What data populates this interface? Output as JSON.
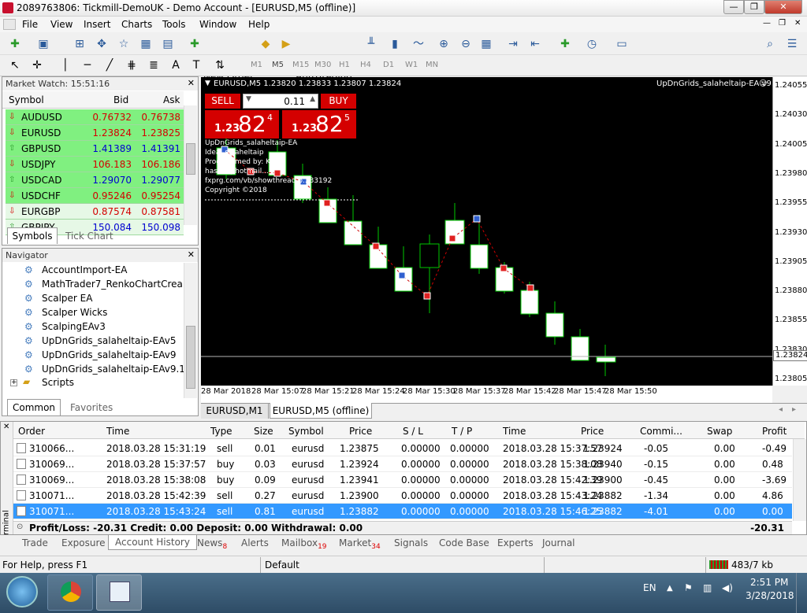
{
  "window": {
    "title": "2089763806: Tickmill-DemoUK - Demo Account - [EURUSD,M5 (offline)]",
    "min": "—",
    "max": "❐",
    "close": "✕"
  },
  "menu": [
    "File",
    "View",
    "Insert",
    "Charts",
    "Tools",
    "Window",
    "Help"
  ],
  "toolbar": {
    "new_order": "New Order",
    "autotrading": "AutoTrading"
  },
  "timeframes": [
    "M1",
    "M5",
    "M15",
    "M30",
    "H1",
    "H4",
    "D1",
    "W1",
    "MN"
  ],
  "market_watch": {
    "title": "Market Watch: 15:51:16",
    "cols": [
      "Symbol",
      "Bid",
      "Ask"
    ],
    "rows": [
      {
        "s": "AUDUSD",
        "b": "0.76732",
        "a": "0.76738",
        "dir": "down"
      },
      {
        "s": "EURUSD",
        "b": "1.23824",
        "a": "1.23825",
        "dir": "down"
      },
      {
        "s": "GBPUSD",
        "b": "1.41389",
        "a": "1.41391",
        "dir": "up"
      },
      {
        "s": "USDJPY",
        "b": "106.183",
        "a": "106.186",
        "dir": "down"
      },
      {
        "s": "USDCAD",
        "b": "1.29070",
        "a": "1.29077",
        "dir": "up"
      },
      {
        "s": "USDCHF",
        "b": "0.95246",
        "a": "0.95254",
        "dir": "down"
      },
      {
        "s": "EURGBP",
        "b": "0.87574",
        "a": "0.87581",
        "dir": "down"
      },
      {
        "s": "GBPJPY",
        "b": "150.084",
        "a": "150.098",
        "dir": "up"
      }
    ],
    "tabs": [
      "Symbols",
      "Tick Chart"
    ]
  },
  "navigator": {
    "title": "Navigator",
    "items": [
      "AccountImport-EA",
      "MathTrader7_RenkoChartCrea",
      "Scalper EA",
      "Scalper Wicks",
      "ScalpingEAv3",
      "UpDnGrids_salaheltaip-EAv5",
      "UpDnGrids_salaheltaip-EAv9",
      "UpDnGrids_salaheltaip-EAv9.1"
    ],
    "scripts": "Scripts",
    "tabs": [
      "Common",
      "Favorites"
    ]
  },
  "chart": {
    "header": "EURUSD,M5  1.23820 1.23833 1.23807 1.23824",
    "ea_name": "UpDnGrids_salaheltaip-EA v9.1",
    "sell_label": "SELL",
    "buy_label": "BUY",
    "lot": "0.11",
    "sell_price_small": "1.23",
    "sell_price_big": "82",
    "sell_price_sup": "4",
    "buy_price_small": "1.23",
    "buy_price_big": "82",
    "buy_price_sup": "5",
    "info_lines": [
      "UpDnGrids_salaheltaip-EA",
      "Idea: salaheltaip",
      "Programmed by: Kir...",
      "hass...@hotmail...",
      "fxprg.com/vb/showthread.p...33192",
      "Copyright ©2018"
    ],
    "price_labels": [
      "1.24055",
      "1.24030",
      "1.24005",
      "1.23980",
      "1.23955",
      "1.23930",
      "1.23905",
      "1.23880",
      "1.23855",
      "1.23830",
      "1.23805"
    ],
    "current_price": "1.23824",
    "time_labels": [
      "28 Mar 2018",
      "28 Mar 15:07",
      "28 Mar 15:21",
      "28 Mar 15:24",
      "28 Mar 15:30",
      "28 Mar 15:37",
      "28 Mar 15:42",
      "28 Mar 15:47",
      "28 Mar 15:50"
    ],
    "tabs": [
      "EURUSD,M1",
      "EURUSD,M5 (offline)"
    ],
    "colors": {
      "bg": "#000000",
      "candle": "#00c800",
      "sell_box": "#d40000",
      "current_line": "#b4b4b4"
    }
  },
  "terminal": {
    "cols": [
      "Order",
      "Time",
      "Type",
      "Size",
      "Symbol",
      "Price",
      "S / L",
      "T / P",
      "Time",
      "Price",
      "Commi...",
      "Swap",
      "Profit"
    ],
    "rows": [
      [
        "310066...",
        "2018.03.28 15:31:19",
        "sell",
        "0.01",
        "eurusd",
        "1.23875",
        "0.00000",
        "0.00000",
        "2018.03.28 15:37:57",
        "1.23924",
        "-0.05",
        "0.00",
        "-0.49"
      ],
      [
        "310069...",
        "2018.03.28 15:37:57",
        "buy",
        "0.03",
        "eurusd",
        "1.23924",
        "0.00000",
        "0.00000",
        "2018.03.28 15:38:08",
        "1.23940",
        "-0.15",
        "0.00",
        "0.48"
      ],
      [
        "310069...",
        "2018.03.28 15:38:08",
        "buy",
        "0.09",
        "eurusd",
        "1.23941",
        "0.00000",
        "0.00000",
        "2018.03.28 15:42:39",
        "1.23900",
        "-0.45",
        "0.00",
        "-3.69"
      ],
      [
        "310071...",
        "2018.03.28 15:42:39",
        "sell",
        "0.27",
        "eurusd",
        "1.23900",
        "0.00000",
        "0.00000",
        "2018.03.28 15:43:24",
        "1.23882",
        "-1.34",
        "0.00",
        "4.86"
      ],
      [
        "310071...",
        "2018.03.28 15:43:24",
        "sell",
        "0.81",
        "eurusd",
        "1.23882",
        "0.00000",
        "0.00000",
        "2018.03.28 15:46:25",
        "1.23882",
        "-4.01",
        "0.00",
        "0.00"
      ]
    ],
    "summary": "Profit/Loss: -20.31  Credit: 0.00  Deposit: 0.00  Withdrawal: 0.00",
    "summary_total": "-20.31",
    "side_label": "Terminal",
    "tabs": [
      {
        "label": "Trade",
        "badge": ""
      },
      {
        "label": "Exposure",
        "badge": ""
      },
      {
        "label": "Account History",
        "badge": ""
      },
      {
        "label": "News",
        "badge": "8"
      },
      {
        "label": "Alerts",
        "badge": ""
      },
      {
        "label": "Mailbox",
        "badge": "19"
      },
      {
        "label": "Market",
        "badge": "34"
      },
      {
        "label": "Signals",
        "badge": ""
      },
      {
        "label": "Code Base",
        "badge": ""
      },
      {
        "label": "Experts",
        "badge": ""
      },
      {
        "label": "Journal",
        "badge": ""
      }
    ]
  },
  "status": {
    "help": "For Help, press F1",
    "profile": "Default",
    "traffic": "483/7 kb"
  },
  "taskbar": {
    "lang": "EN",
    "time": "2:51 PM",
    "date": "3/28/2018"
  }
}
